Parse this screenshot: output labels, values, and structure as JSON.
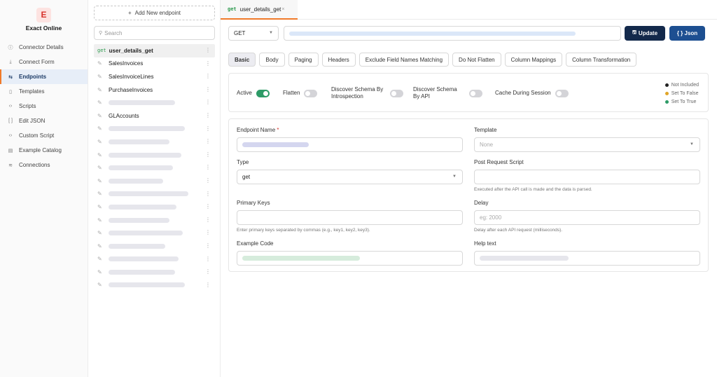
{
  "app": {
    "brand_letter": "E",
    "brand_name": "Exact Online"
  },
  "nav": {
    "items": [
      {
        "label": "Connector Details",
        "icon": "info-icon",
        "glyph": "ⓘ",
        "active": false
      },
      {
        "label": "Connect Form",
        "icon": "download-icon",
        "glyph": "⤓",
        "active": false
      },
      {
        "label": "Endpoints",
        "icon": "endpoints-icon",
        "glyph": "⇆",
        "active": true
      },
      {
        "label": "Templates",
        "icon": "template-icon",
        "glyph": "▯",
        "active": false
      },
      {
        "label": "Scripts",
        "icon": "code-icon",
        "glyph": "‹›",
        "active": false
      },
      {
        "label": "Edit JSON",
        "icon": "brackets-icon",
        "glyph": "[ ]",
        "active": false
      },
      {
        "label": "Custom Script",
        "icon": "code-icon",
        "glyph": "‹›",
        "active": false
      },
      {
        "label": "Example Catalog",
        "icon": "catalog-icon",
        "glyph": "▤",
        "active": false
      },
      {
        "label": "Connections",
        "icon": "database-icon",
        "glyph": "≋",
        "active": false
      }
    ]
  },
  "endpoints": {
    "add_label": "Add New endpoint",
    "search_placeholder": "Search",
    "items": [
      {
        "method": "get",
        "label": "user_details_get",
        "active": true
      },
      {
        "label": "SalesInvoices"
      },
      {
        "label": "SalesInvoiceLines"
      },
      {
        "label": "PurchaseInvoices"
      },
      {
        "label": "",
        "placeholder_fraction": 0.55
      },
      {
        "label": "GLAccounts"
      },
      {
        "label": "",
        "placeholder_fraction": 0.63
      },
      {
        "label": "",
        "placeholder_fraction": 0.5
      },
      {
        "label": "",
        "placeholder_fraction": 0.6
      },
      {
        "label": "",
        "placeholder_fraction": 0.53
      },
      {
        "label": "",
        "placeholder_fraction": 0.45
      },
      {
        "label": "",
        "placeholder_fraction": 0.66
      },
      {
        "label": "",
        "placeholder_fraction": 0.56
      },
      {
        "label": "",
        "placeholder_fraction": 0.5
      },
      {
        "label": "",
        "placeholder_fraction": 0.61
      },
      {
        "label": "",
        "placeholder_fraction": 0.47
      },
      {
        "label": "",
        "placeholder_fraction": 0.58
      },
      {
        "label": "",
        "placeholder_fraction": 0.55
      },
      {
        "label": "",
        "placeholder_fraction": 0.63
      }
    ]
  },
  "tab": {
    "method": "get",
    "name": "user_details_get",
    "close": "×"
  },
  "request": {
    "method": "GET",
    "update_label": "Update",
    "json_label": "{ } Json"
  },
  "subtabs": [
    {
      "label": "Basic",
      "active": true
    },
    {
      "label": "Body"
    },
    {
      "label": "Paging"
    },
    {
      "label": "Headers"
    },
    {
      "label": "Exclude Field Names Matching"
    },
    {
      "label": "Do Not Flatten"
    },
    {
      "label": "Column Mappings"
    },
    {
      "label": "Column Transformation"
    }
  ],
  "toggles": [
    {
      "label": "Active",
      "on": true
    },
    {
      "label": "Flatten",
      "on": false
    },
    {
      "label": "Discover Schema By Introspection",
      "on": false
    },
    {
      "label": "Discover Schema By API",
      "on": false
    },
    {
      "label": "Cache During Session",
      "on": false
    }
  ],
  "legend": [
    {
      "label": "Not Included",
      "color": "#222222"
    },
    {
      "label": "Set To False",
      "color": "#e0a528"
    },
    {
      "label": "Set To True",
      "color": "#2e9b67"
    }
  ],
  "form": {
    "endpoint_name": {
      "label": "Endpoint Name",
      "required": "*"
    },
    "template": {
      "label": "Template",
      "value": "None"
    },
    "type": {
      "label": "Type",
      "value": "get"
    },
    "post_request_script": {
      "label": "Post Request Script",
      "hint": "Executed after the API call is made and the data is parsed."
    },
    "primary_keys": {
      "label": "Primary Keys",
      "hint": "Enter primary keys separated by commas (e.g., key1, key2, key3)."
    },
    "delay": {
      "label": "Delay",
      "placeholder": "eg: 2000",
      "hint": "Delay after each API request (milliseconds)."
    },
    "example_code": {
      "label": "Example Code"
    },
    "help_text": {
      "label": "Help text"
    }
  },
  "colors": {
    "accent": "#f07a2a",
    "primary_dark": "#13294b",
    "primary": "#1d4f91",
    "success": "#2e9b67"
  }
}
